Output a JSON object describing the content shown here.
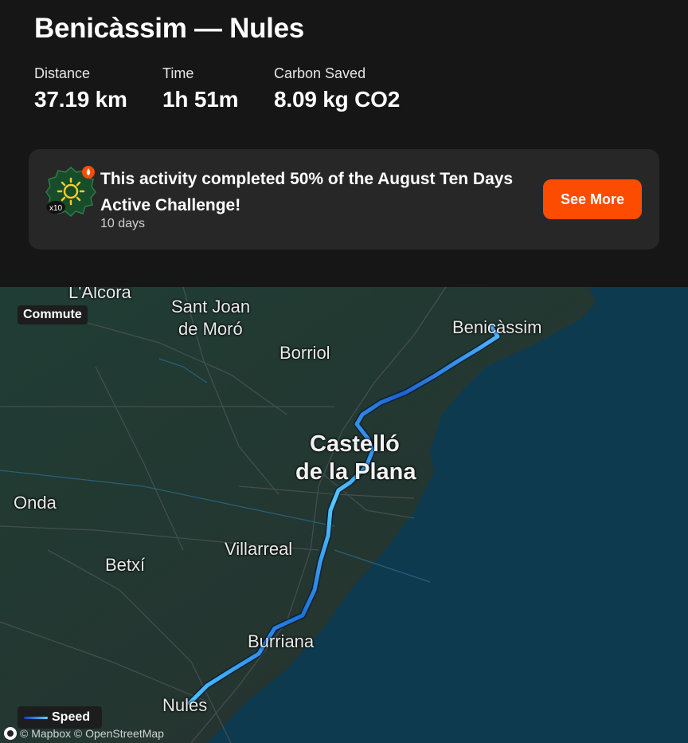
{
  "activity": {
    "title": "Benicàssim — Nules",
    "stats": [
      {
        "label": "Distance",
        "value": "37.19 km"
      },
      {
        "label": "Time",
        "value": "1h 51m"
      },
      {
        "label": "Carbon Saved",
        "value": "8.09 kg CO2"
      }
    ]
  },
  "challenge": {
    "text": "This activity completed 50% of the August Ten Days Active Challenge!",
    "subtext": "10 days",
    "button_label": "See More",
    "badge_text": "x10",
    "accent": "#fc4c02"
  },
  "map": {
    "activity_type": "Commute",
    "legend_label": "Speed",
    "attribution": "© Mapbox © OpenStreetMap",
    "places": {
      "alcora": "L'Alcora",
      "sant_joan_1": "Sant Joan",
      "sant_joan_2": "de Moró",
      "borriol": "Borriol",
      "benicassim": "Benicàssim",
      "castello_1": "Castelló",
      "castello_2": "de la Plana",
      "onda": "Onda",
      "villarreal": "Villarreal",
      "betxi": "Betxí",
      "burriana": "Burriana",
      "nules": "Nules"
    }
  }
}
